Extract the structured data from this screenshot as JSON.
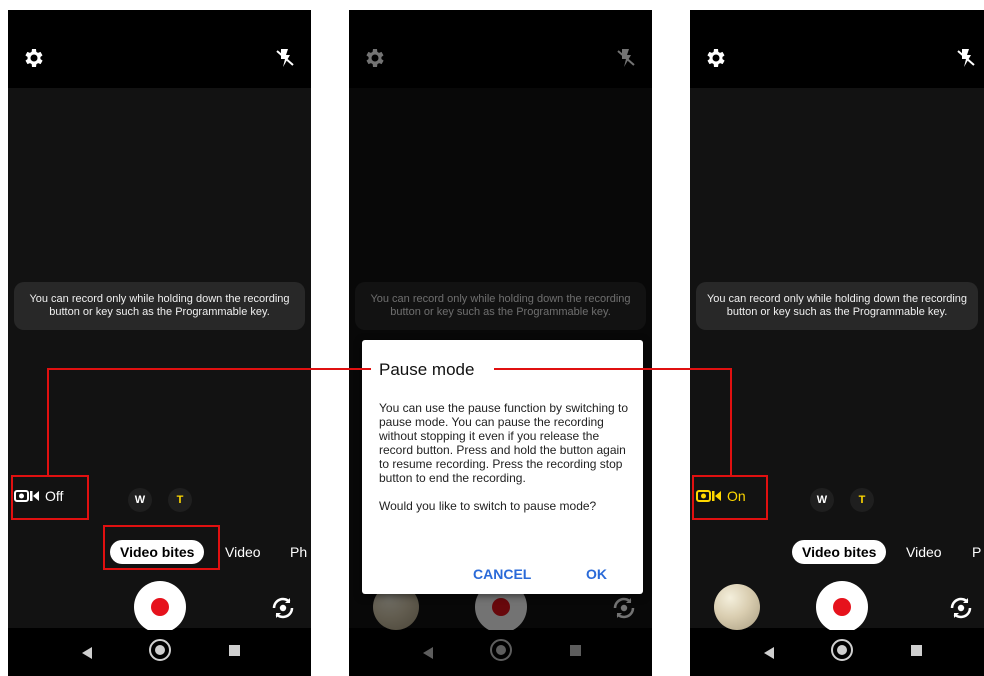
{
  "toast_text": "You can record only while holding down the recording button or key such as the Programmable key.",
  "zoom": {
    "wide": "W",
    "tele": "T"
  },
  "modes": {
    "video_bites": "Video bites",
    "video": "Video",
    "photo_partial": "Ph",
    "photo_partial_right": "P"
  },
  "left_phone": {
    "pause_label": "Off"
  },
  "right_phone": {
    "pause_label": "On"
  },
  "dialog": {
    "title": "Pause mode",
    "body_paragraph_1": "You can use the pause function by switching to pause mode. You can pause the recording without stopping it even if you release the record button. Press and hold the button again to resume recording. Press the recording stop button to end the recording.",
    "body_paragraph_2": "Would you like to switch to pause mode?",
    "cancel_label": "CANCEL",
    "ok_label": "OK"
  },
  "colors": {
    "highlight": "#e01010",
    "active_yellow": "#ffd800",
    "record_red": "#e6121c",
    "dialog_button": "#2a6ad8"
  },
  "icons": [
    "gear-icon",
    "flash-off-icon",
    "pause-mode-icon",
    "switch-camera-icon",
    "nav-back-icon",
    "nav-home-icon",
    "nav-recent-icon"
  ]
}
